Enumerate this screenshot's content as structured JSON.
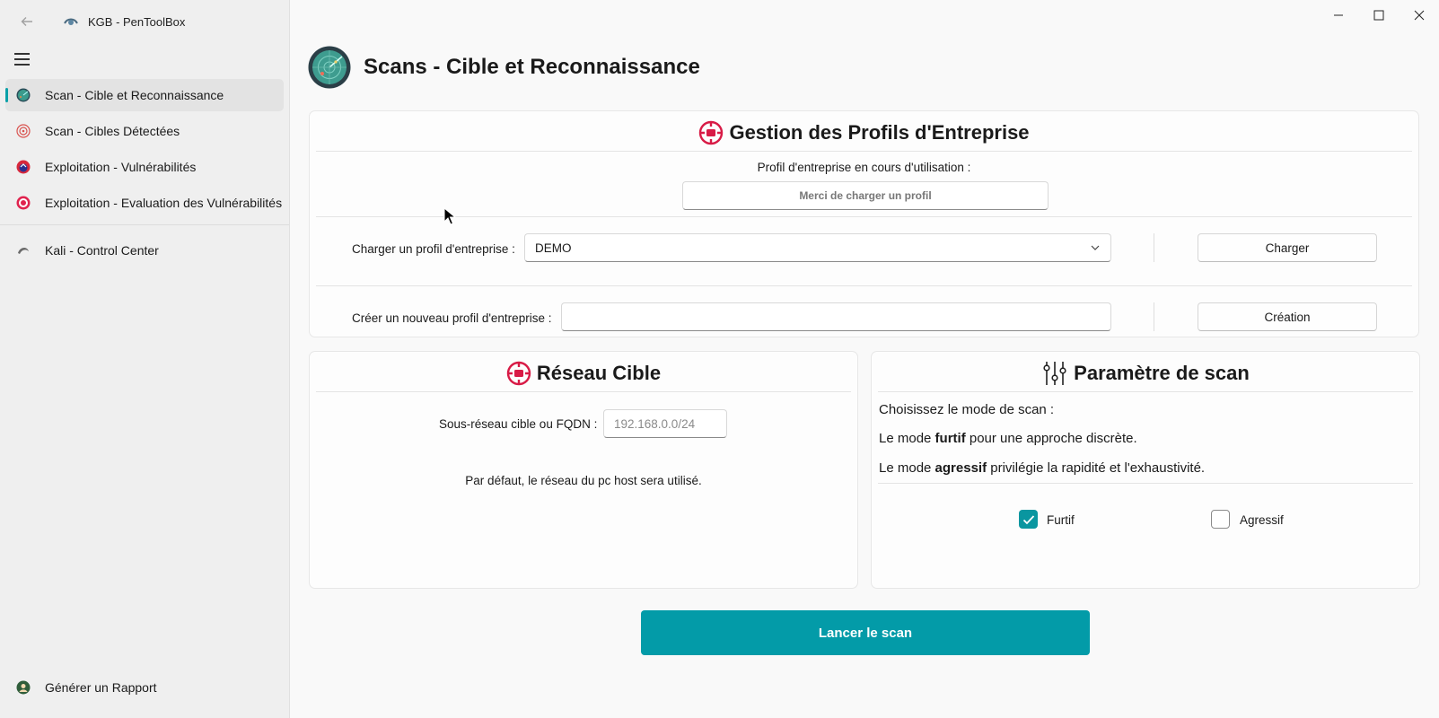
{
  "window": {
    "app_title": "KGB - PenToolBox",
    "controls": [
      "minimize-icon",
      "maximize-icon",
      "close-icon"
    ]
  },
  "sidebar": {
    "items": [
      {
        "label": "Scan - Cible et Reconnaissance",
        "icon": "radar-icon",
        "active": true
      },
      {
        "label": "Scan - Cibles Détectées",
        "icon": "target-icon"
      },
      {
        "label": "Exploitation - Vulnérabilités",
        "icon": "exploit-icon"
      },
      {
        "label": "Exploitation - Evaluation des Vulnérabilités",
        "icon": "target-alert-icon"
      },
      {
        "label": "Kali - Control Center",
        "icon": "kali-icon"
      }
    ],
    "footer": {
      "label": "Générer un Rapport",
      "icon": "report-icon"
    }
  },
  "page": {
    "title": "Scans - Cible et Reconnaissance"
  },
  "profiles": {
    "title": "Gestion des Profils d'Entreprise",
    "current_label": "Profil d'entreprise en cours d'utilisation :",
    "current_value": "Merci de charger un profil",
    "load_label": "Charger un profil d'entreprise :",
    "load_selected": "DEMO",
    "load_button": "Charger",
    "create_label": "Créer un nouveau profil d'entreprise :",
    "create_value": "",
    "create_button": "Création"
  },
  "network": {
    "title": "Réseau Cible",
    "subnet_label": "Sous-réseau cible ou FQDN :",
    "subnet_placeholder": "192.168.0.0/24",
    "default_note": "Par défaut, le réseau du pc host sera utilisé."
  },
  "scan_params": {
    "title": "Paramètre de scan",
    "intro": "Choisissez le mode de scan :",
    "furtif_line": {
      "prefix": "Le mode ",
      "bold": "furtif",
      "suffix": " pour une approche discrète."
    },
    "agressif_line": {
      "prefix": "Le mode ",
      "bold": "agressif",
      "suffix": " privilégie la rapidité et l'exhaustivité."
    },
    "options": [
      {
        "label": "Furtif",
        "checked": true
      },
      {
        "label": "Agressif",
        "checked": false
      }
    ]
  },
  "actions": {
    "launch": "Lancer le scan"
  },
  "colors": {
    "accent": "#039ba8",
    "target_red": "#d81b46"
  }
}
